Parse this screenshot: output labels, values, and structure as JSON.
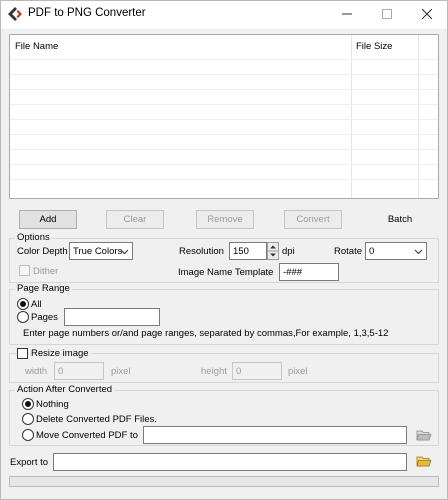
{
  "window": {
    "title": "PDF to PNG Converter"
  },
  "file_list": {
    "columns": [
      "File Name",
      "File Size"
    ]
  },
  "toolbar": {
    "add": "Add",
    "clear": "Clear",
    "remove": "Remove",
    "convert": "Convert",
    "batch": "Batch"
  },
  "options": {
    "group_label": "Options",
    "color_depth_label": "Color Depth",
    "color_depth_value": "True Colors",
    "resolution_label": "Resolution",
    "resolution_value": "150",
    "resolution_unit": "dpi",
    "rotate_label": "Rotate",
    "rotate_value": "0",
    "dither_label": "Dither",
    "image_name_template_label": "Image Name Template",
    "image_name_template_value": "-###"
  },
  "page_range": {
    "group_label": "Page Range",
    "all_label": "All",
    "pages_label": "Pages",
    "pages_value": "",
    "hint": "Enter page numbers or/and page ranges, separated by commas,For example, 1,3,5-12"
  },
  "resize": {
    "label": "Resize image",
    "width_label": "width",
    "width_value": "0",
    "width_unit": "pixel",
    "height_label": "height",
    "height_value": "0",
    "height_unit": "pixel"
  },
  "after_convert": {
    "group_label": "Action After Converted",
    "nothing_label": "Nothing",
    "delete_label": "Delete Converted PDF Files.",
    "move_label": "Move Converted PDF to",
    "move_path": ""
  },
  "export": {
    "label": "Export to",
    "path": ""
  },
  "colors": {
    "app_icon_dark": "#333333",
    "app_icon_accent": "#d42a1e",
    "folder": "#e8b838"
  },
  "icons": {
    "app": "app-logo-icon",
    "folder": "folder-open-icon"
  }
}
